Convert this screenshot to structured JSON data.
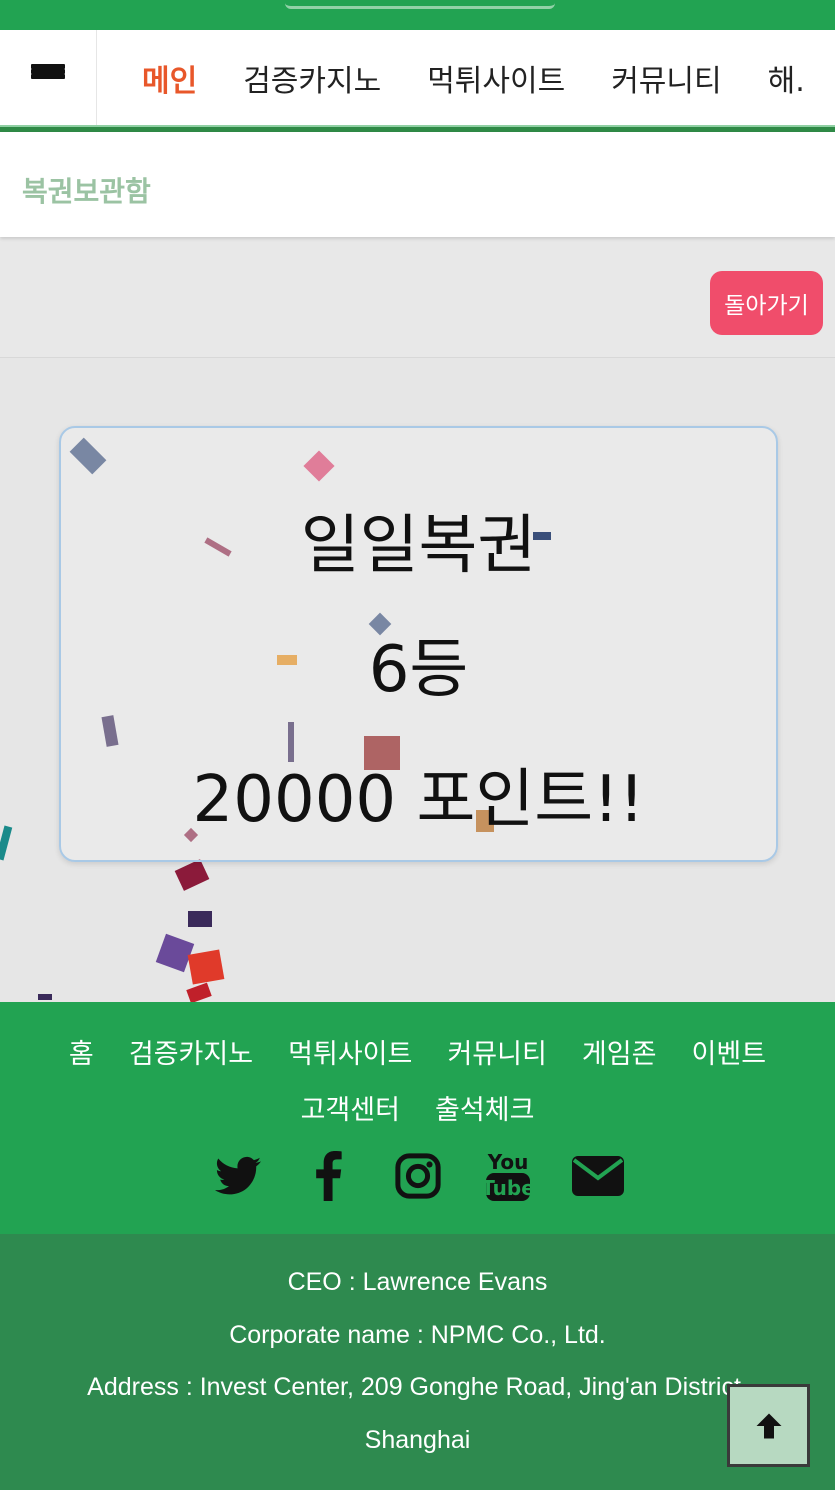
{
  "nav": {
    "items": [
      "메인",
      "검증카지노",
      "먹튀사이트",
      "커뮤니티",
      "해."
    ]
  },
  "subheader": {
    "title": "복권보관함"
  },
  "back_button": "돌아가기",
  "result": {
    "line1": "일일복권",
    "line2": "6등",
    "line3": "20000 포인트!!"
  },
  "footer": {
    "links": [
      "홈",
      "검증카지노",
      "먹튀사이트",
      "커뮤니티",
      "게임존",
      "이벤트",
      "고객센터",
      "출석체크"
    ],
    "socials": [
      "twitter-icon",
      "facebook-icon",
      "instagram-icon",
      "youtube-icon",
      "envelope-icon"
    ]
  },
  "company": {
    "ceo": "CEO : Lawrence Evans",
    "corp": "Corporate name : NPMC Co., Ltd.",
    "address": "Address : Invest Center, 209 Gonghe Road, Jing'an District,",
    "city": "Shanghai"
  },
  "colors": {
    "green": "#22a352",
    "dark_green": "#2e8a4f",
    "active_nav": "#e8572a",
    "back_button": "#f04d6b"
  }
}
